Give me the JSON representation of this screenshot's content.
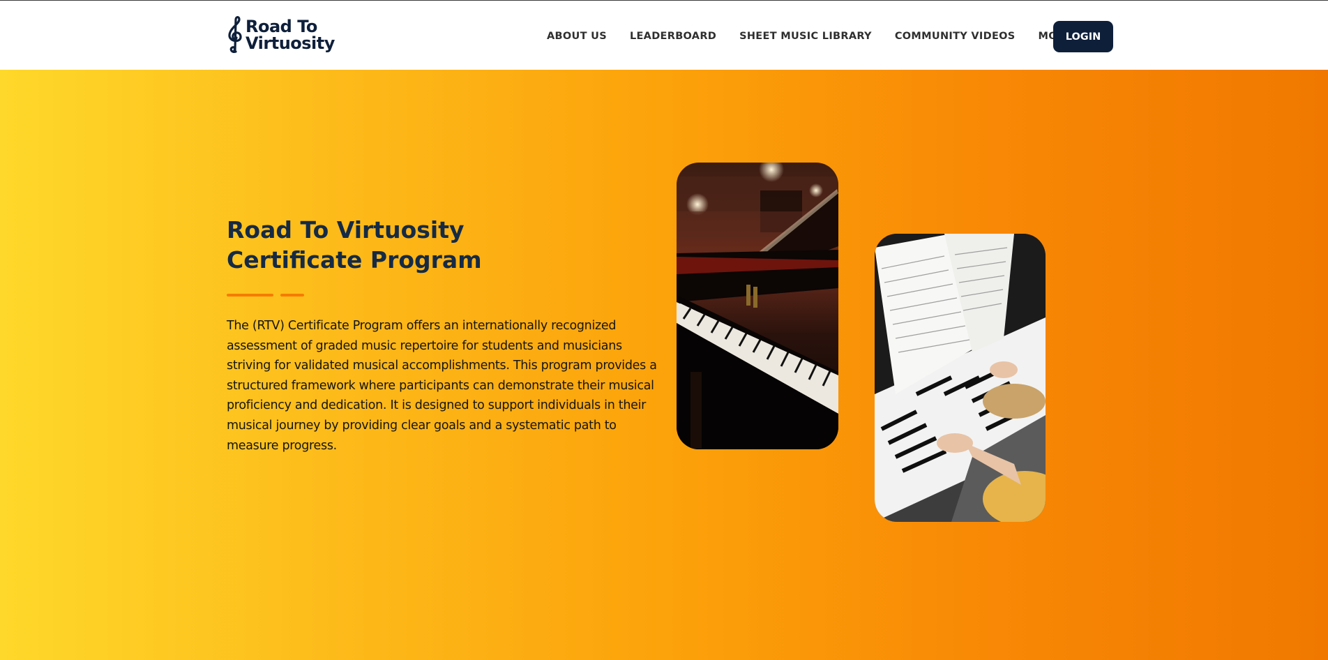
{
  "brand": {
    "name_line1": "Road To",
    "name_line2": "Virtuosity",
    "logo_icon": "treble-clef-icon",
    "color": "#0e1f3a"
  },
  "nav": {
    "items": [
      {
        "label": "ABOUT US"
      },
      {
        "label": "LEADERBOARD"
      },
      {
        "label": "SHEET MUSIC LIBRARY"
      },
      {
        "label": "COMMUNITY VIDEOS"
      },
      {
        "label": "MORE",
        "icon": "chevron-down-icon"
      }
    ],
    "login_label": "LOGIN"
  },
  "hero": {
    "title_line1": "Road To Virtuosity",
    "title_line2": "Certificate Program",
    "description_lines": [
      "The (RTV) Certificate Program offers an internationally recognized",
      "assessment of graded music repertoire for students and musicians",
      "striving for validated musical accomplishments. This program provides a",
      "structured framework where participants can demonstrate their musical",
      "proficiency and dedication. It is designed to support individuals in their",
      "musical journey by providing clear goals and a systematic path to",
      "measure progress."
    ],
    "accent_color": "#f57c00",
    "gradient_start": "#fed82a",
    "gradient_end": "#f07800"
  },
  "images": [
    {
      "name": "grand-piano-photo"
    },
    {
      "name": "piano-sheet-music-photo"
    }
  ]
}
